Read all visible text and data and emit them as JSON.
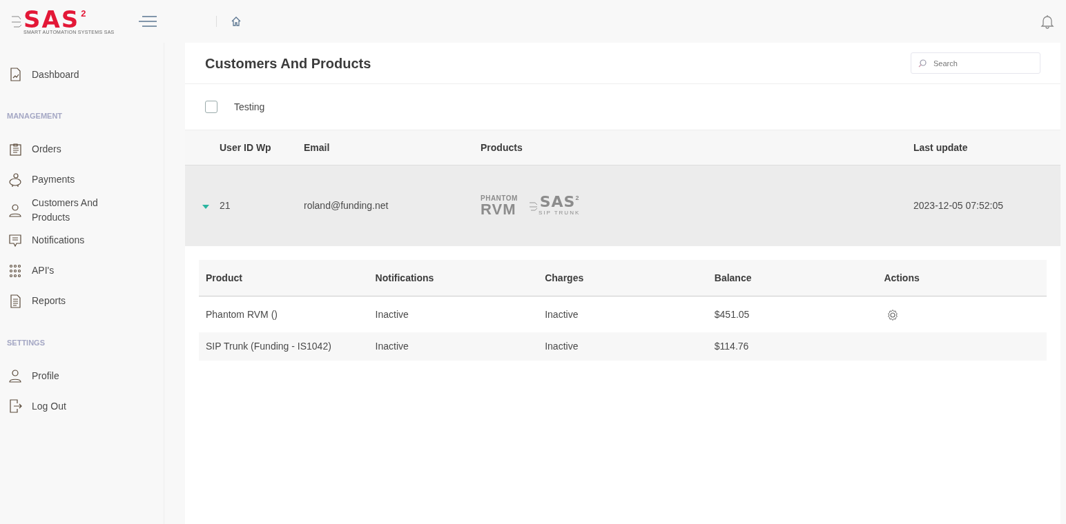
{
  "logo": {
    "mark": "SAS",
    "superscript": "2",
    "tagline": "SMART AUTOMATION SYSTEMS SAS"
  },
  "sidebar": {
    "sections": [
      {
        "items": [
          {
            "label": "Dashboard"
          }
        ]
      },
      {
        "heading": "MANAGEMENT",
        "items": [
          {
            "label": "Orders"
          },
          {
            "label": "Payments"
          },
          {
            "label": "Customers And Products"
          },
          {
            "label": "Notifications"
          },
          {
            "label": "API's"
          },
          {
            "label": "Reports"
          }
        ]
      },
      {
        "heading": "SETTINGS",
        "items": [
          {
            "label": "Profile"
          },
          {
            "label": "Log Out"
          }
        ]
      }
    ]
  },
  "page": {
    "title": "Customers And Products",
    "search": {
      "placeholder": "Search"
    },
    "filter": {
      "label": "Testing",
      "checked": false
    }
  },
  "table": {
    "columns": [
      "User ID Wp",
      "Email",
      "Products",
      "Last update"
    ],
    "rows": [
      {
        "expanded": true,
        "user_id": "21",
        "email": "roland@funding.net",
        "last_update": "2023-12-05 07:52:05",
        "products": [
          {
            "kind": "phantom",
            "top": "PHANTOM",
            "bottom": "RVM"
          },
          {
            "kind": "sas",
            "mark": "SAS",
            "superscript": "2",
            "caption": "SIP TRUNK"
          }
        ],
        "detail": {
          "columns": [
            "Product",
            "Notifications",
            "Charges",
            "Balance",
            "Actions"
          ],
          "rows": [
            {
              "product": "Phantom RVM ()",
              "notifications": "Inactive",
              "charges": "Inactive",
              "balance": "$451.05",
              "settings_action": true
            },
            {
              "product": "SIP Trunk (Funding - IS1042)",
              "notifications": "Inactive",
              "charges": "Inactive",
              "balance": "$114.76",
              "settings_action": false
            }
          ]
        }
      }
    ]
  }
}
